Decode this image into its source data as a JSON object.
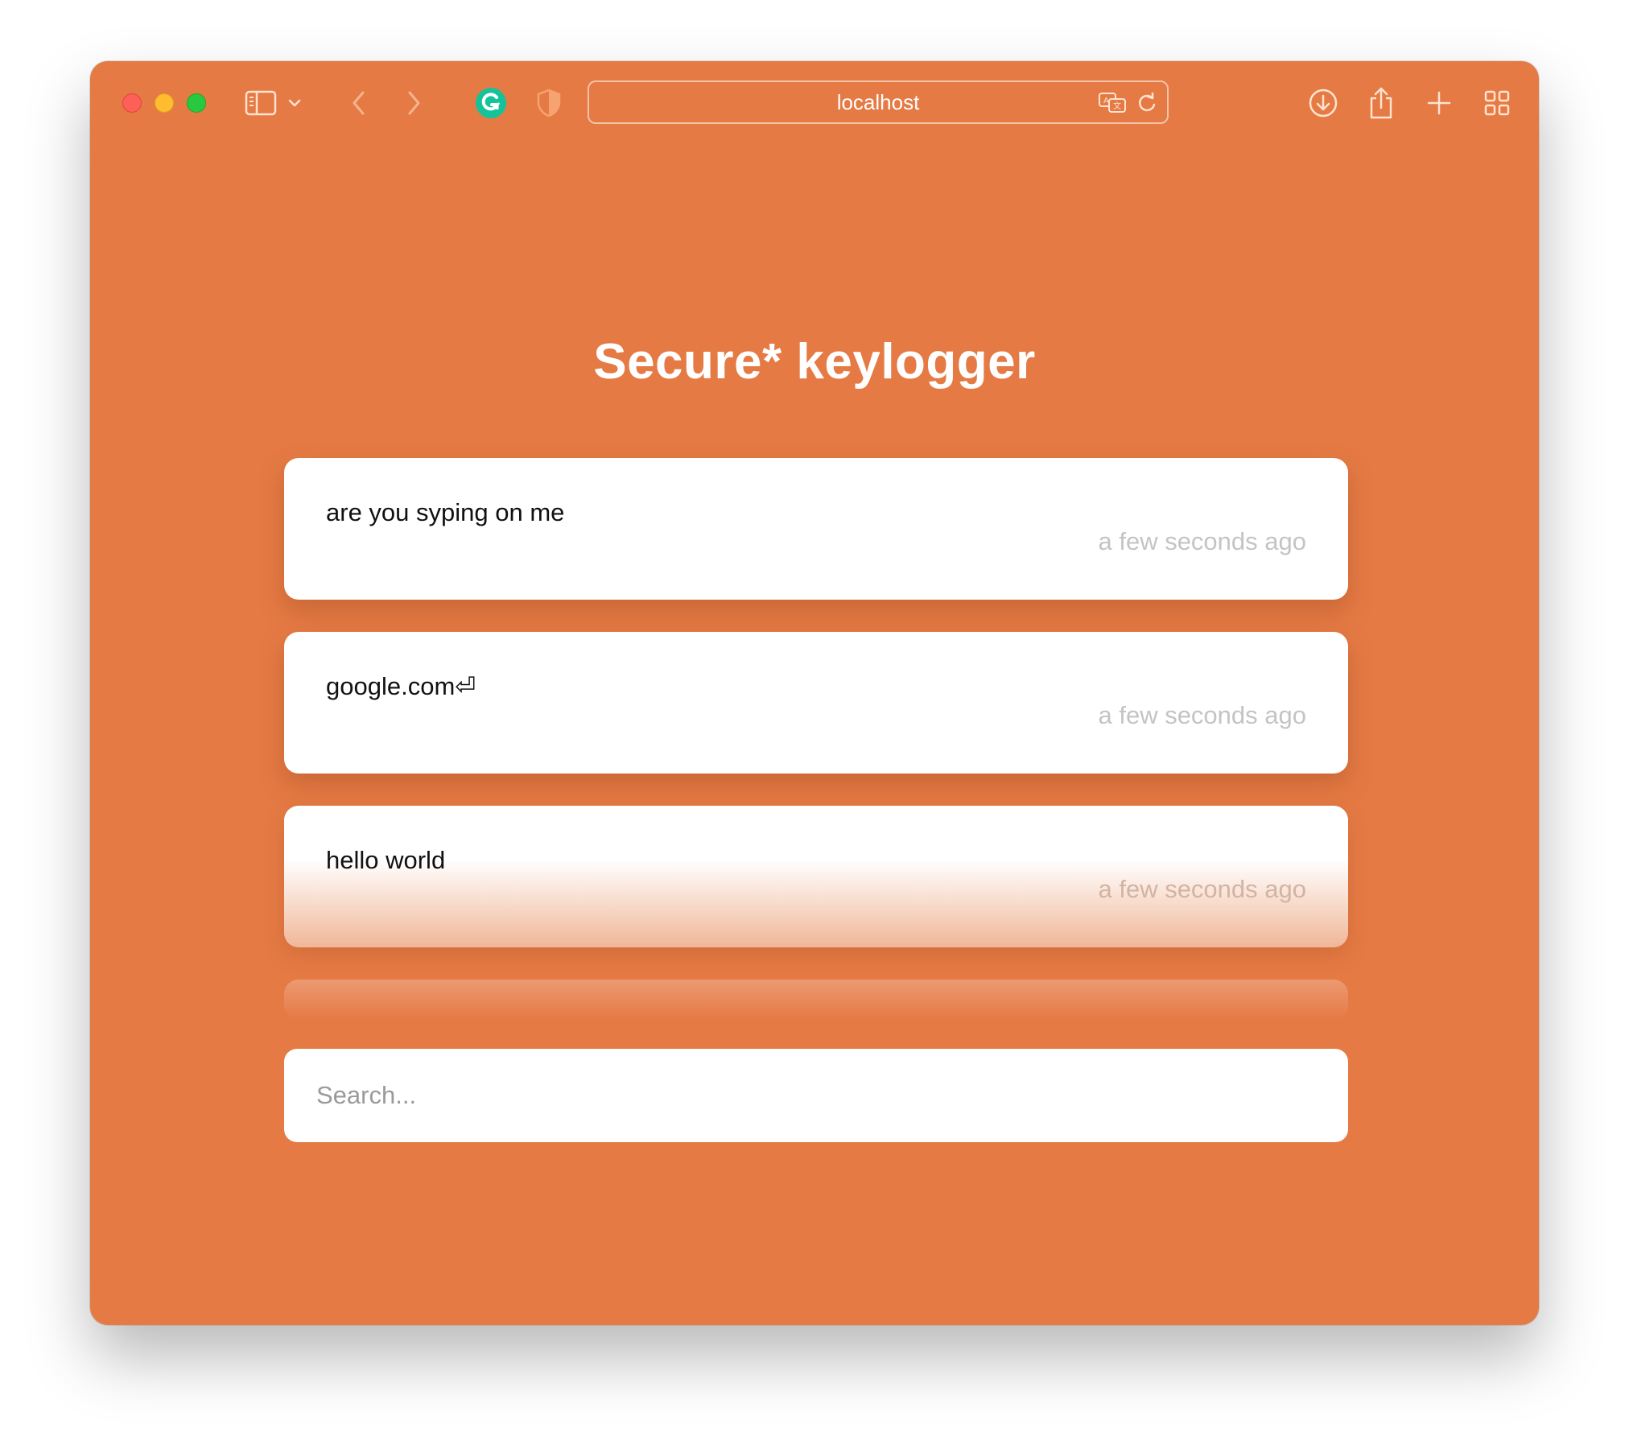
{
  "browser": {
    "address_bar": {
      "url": "localhost"
    },
    "toolbar_icons": [
      "sidebar-icon",
      "chevron-down-icon",
      "back-icon",
      "forward-icon",
      "grammarly-icon",
      "shield-icon",
      "translate-icon",
      "reload-icon",
      "download-icon",
      "share-icon",
      "new-tab-icon",
      "tab-overview-icon"
    ]
  },
  "colors": {
    "page_background": "#e57a44",
    "card_background": "#ffffff",
    "timestamp": "#c4c4c4"
  },
  "page": {
    "title": "Secure* keylogger",
    "entries": [
      {
        "text": "are you syping on me",
        "time": "a few seconds ago"
      },
      {
        "text": "google.com⏎",
        "time": "a few seconds ago"
      },
      {
        "text": "hello world",
        "time": "a few seconds ago"
      }
    ],
    "search": {
      "placeholder": "Search...",
      "value": ""
    }
  }
}
